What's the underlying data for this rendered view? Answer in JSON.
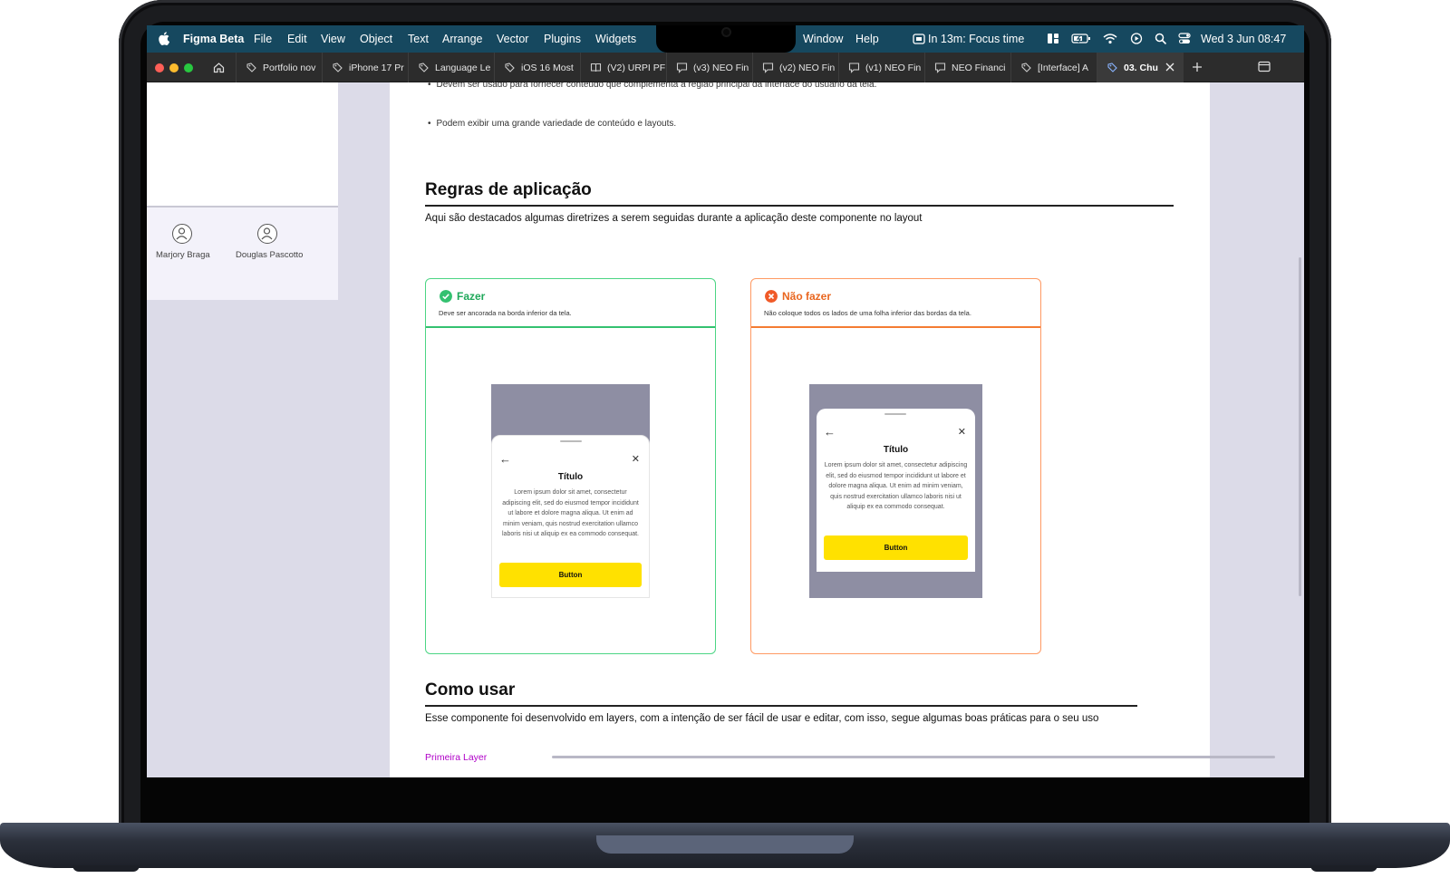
{
  "menubar": {
    "app_name": "Figma Beta",
    "menus": [
      "File",
      "Edit",
      "View",
      "Object",
      "Text",
      "Arrange",
      "Vector",
      "Plugins",
      "Widgets"
    ],
    "right_menus": [
      "Window",
      "Help"
    ],
    "focus_status": "In 13m: Focus time",
    "datetime": "Wed 3 Jun  08:47"
  },
  "tabs": [
    {
      "label": "Portfolio nov",
      "icon": "figma-file-icon"
    },
    {
      "label": "iPhone 17 Pr",
      "icon": "figma-file-icon"
    },
    {
      "label": "Language Le",
      "icon": "figma-file-icon"
    },
    {
      "label": "iOS 16 Most",
      "icon": "figma-file-icon"
    },
    {
      "label": "(V2) URPI PF",
      "icon": "figjam-file-icon"
    },
    {
      "label": "(v3) NEO Fin",
      "icon": "prototype-icon"
    },
    {
      "label": "(v2) NEO Fin",
      "icon": "prototype-icon"
    },
    {
      "label": "(v1) NEO Fin",
      "icon": "prototype-icon"
    },
    {
      "label": "NEO Financi",
      "icon": "prototype-icon"
    },
    {
      "label": "[Interface] A",
      "icon": "figma-file-icon"
    },
    {
      "label": "03. Chu",
      "icon": "figma-file-icon"
    }
  ],
  "left_panel": {
    "users": [
      "Marjory Braga",
      "Douglas Pascotto"
    ]
  },
  "doc": {
    "bullets": [
      "Devem ser usado para fornecer conteúdo que complementa a região principal da interface do usuário da tela.",
      "Podem exibir uma grande variedade de conteúdo e layouts."
    ],
    "section1_title": "Regras de aplicação",
    "section1_desc": "Aqui são destacados algumas diretrizes a serem seguidas durante a aplicação deste componente no layout",
    "do_card": {
      "title": "Fazer",
      "subtitle": "Deve ser ancorada na borda inferior da tela."
    },
    "dont_card": {
      "title": "Não fazer",
      "subtitle": "Não coloque todos os lados de uma folha inferior das bordas da tela."
    },
    "sheet": {
      "title": "Título",
      "body": "Lorem ipsum dolor sit amet, consectetur adipiscing elit, sed do eiusmod tempor incididunt ut labore et dolore magna aliqua. Ut enim ad minim veniam, quis nostrud exercitation ullamco laboris nisi ut aliquip ex ea commodo consequat.",
      "button": "Button"
    },
    "section2_title": "Como usar",
    "section2_desc": "Esse componente foi desenvolvido em layers, com a intenção de ser fácil de usar e editar, com isso, segue algumas boas práticas para o seu uso",
    "link": "Primeira Layer"
  },
  "colors": {
    "menubar_bg": "#16485f",
    "do_green": "#34c170",
    "dont_orange": "#f47c32",
    "button_yellow": "#ffe100",
    "canvas_bg": "#dcdbe8",
    "link_purple": "#b000c8"
  }
}
